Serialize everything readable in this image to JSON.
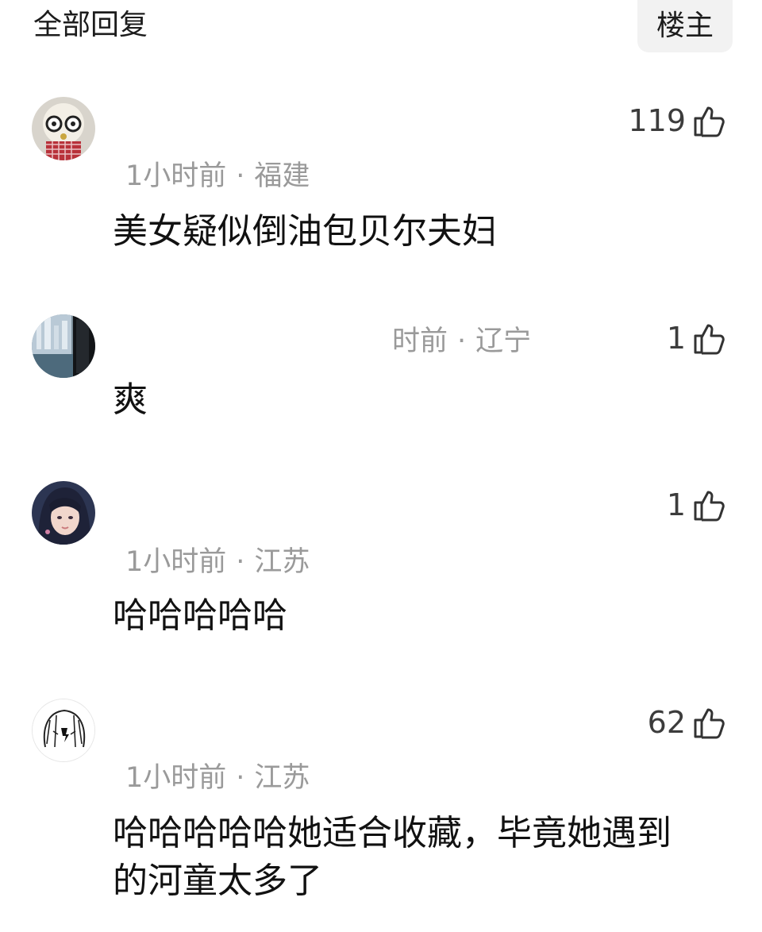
{
  "header": {
    "title": "全部回复",
    "op_filter_label": "楼主"
  },
  "comments": [
    {
      "avatar": "avatar-doll",
      "time": "1小时前",
      "location": "福建",
      "likes": "119",
      "text": "美女疑似倒油包贝尔夫妇"
    },
    {
      "avatar": "avatar-city-window",
      "time": "时前",
      "location": "辽宁",
      "likes": "1",
      "text": "爽"
    },
    {
      "avatar": "avatar-anime-girl",
      "time": "1小时前",
      "location": "江苏",
      "likes": "1",
      "text": "哈哈哈哈哈"
    },
    {
      "avatar": "avatar-sketch-face",
      "time": "1小时前",
      "location": "江苏",
      "likes": "62",
      "text": "哈哈哈哈哈她适合收藏，毕竟她遇到的河童太多了"
    }
  ],
  "icons": {
    "like": "thumbs-up-outline-icon"
  },
  "colors": {
    "meta_text": "#9a9a9a",
    "body_text": "#111111",
    "filter_bg": "#f2f2f2"
  }
}
